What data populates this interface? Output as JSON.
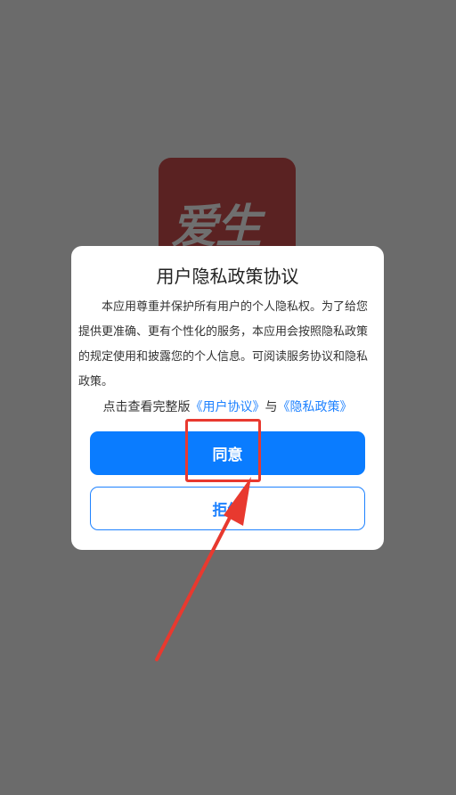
{
  "app": {
    "logo_text": "爱生"
  },
  "dialog": {
    "title": "用户隐私政策协议",
    "body": "本应用尊重并保护所有用户的个人隐私权。为了给您提供更准确、更有个性化的服务，本应用会按照隐私政策的规定使用和披露您的个人信息。可阅读服务协议和隐私政策。",
    "links_prefix": "点击查看完整版",
    "user_agreement_link": "《用户协议》",
    "links_joiner": "与",
    "privacy_policy_link": "《隐私政策》",
    "agree_label": "同意",
    "reject_label": "拒绝"
  },
  "colors": {
    "backdrop": "#6b6b6b",
    "accent": "#0a7cff",
    "annotation": "#e8392f"
  }
}
